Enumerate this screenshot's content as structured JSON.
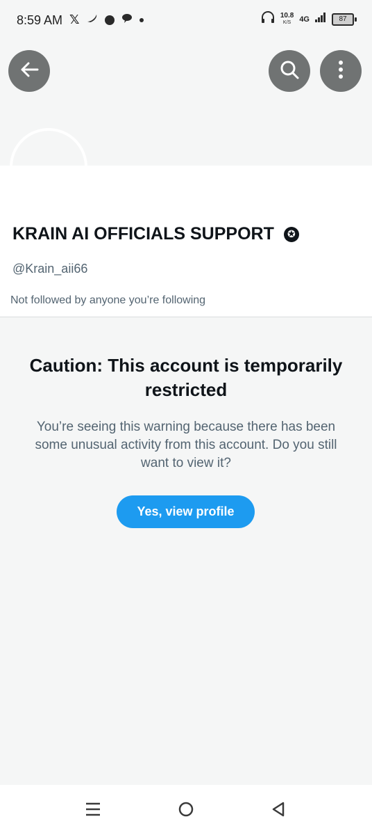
{
  "status_bar": {
    "time": "8:59 AM",
    "x_logo": "𝕏",
    "net_speed_value": "10.8",
    "net_speed_unit": "K/S",
    "network_type": "4G",
    "battery_level": "87",
    "icons": [
      "x-logo-icon",
      "chili-icon",
      "circle-app-icon",
      "chat-bubble-icon",
      "dot-icon",
      "headphones-icon",
      "signal-icon",
      "battery-icon"
    ]
  },
  "header": {
    "back_icon": "arrow-left-icon",
    "search_icon": "search-icon",
    "more_icon": "more-vertical-icon"
  },
  "profile": {
    "display_name": "KRAIN AI OFFICIALS SUPPORT",
    "badge_icon": "star-badge-icon",
    "badge_glyph": "✪",
    "handle": "@Krain_aii66",
    "followed_text": "Not followed by anyone you’re following"
  },
  "caution": {
    "title": "Caution: This account is temporarily restricted",
    "body": "You’re seeing this warning because there has been some unusual activity from this account. Do you still want to view it?",
    "button_label": "Yes, view profile"
  },
  "nav_bar": {
    "icons": [
      "menu-icon",
      "home-icon",
      "back-triangle-icon"
    ]
  },
  "colors": {
    "accent": "#1d9bf0",
    "text_primary": "#0f1419",
    "text_secondary": "#536471",
    "header_button": "#707373"
  }
}
